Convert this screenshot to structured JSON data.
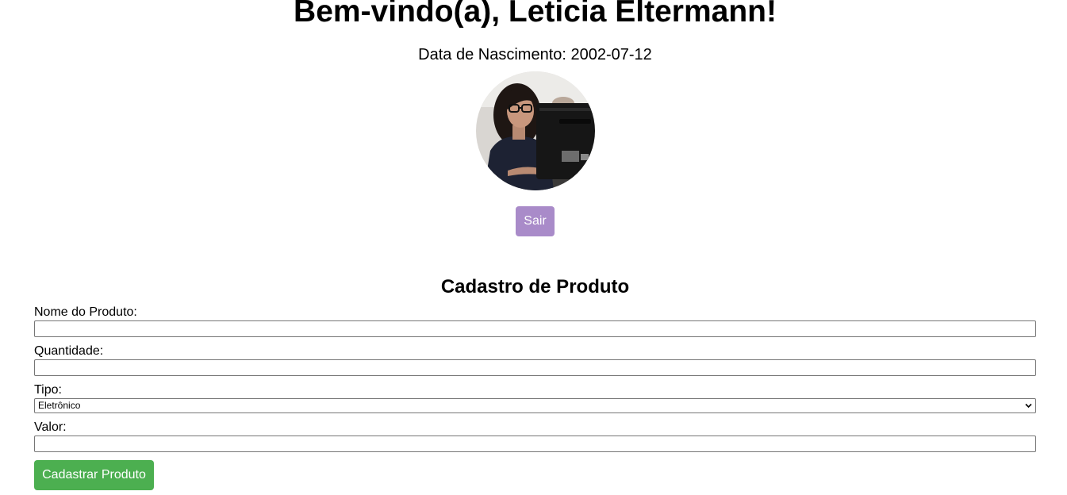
{
  "header": {
    "welcome": "Bem-vindo(a), Leticia Eltermann!",
    "birth_label": "Data de Nascimento:",
    "birth_date": "2002-07-12",
    "logout_label": "Sair"
  },
  "avatar": {
    "icon": "profile-photo"
  },
  "form": {
    "title": "Cadastro de Produto",
    "fields": {
      "name": {
        "label": "Nome do Produto:",
        "value": ""
      },
      "quantity": {
        "label": "Quantidade:",
        "value": ""
      },
      "type": {
        "label": "Tipo:",
        "selected": "Eletrônico"
      },
      "price": {
        "label": "Valor:",
        "value": ""
      }
    },
    "submit_label": "Cadastrar Produto"
  },
  "colors": {
    "logout_button": "#a98bc9",
    "submit_button": "#4caf50",
    "background": "#ffffff"
  }
}
